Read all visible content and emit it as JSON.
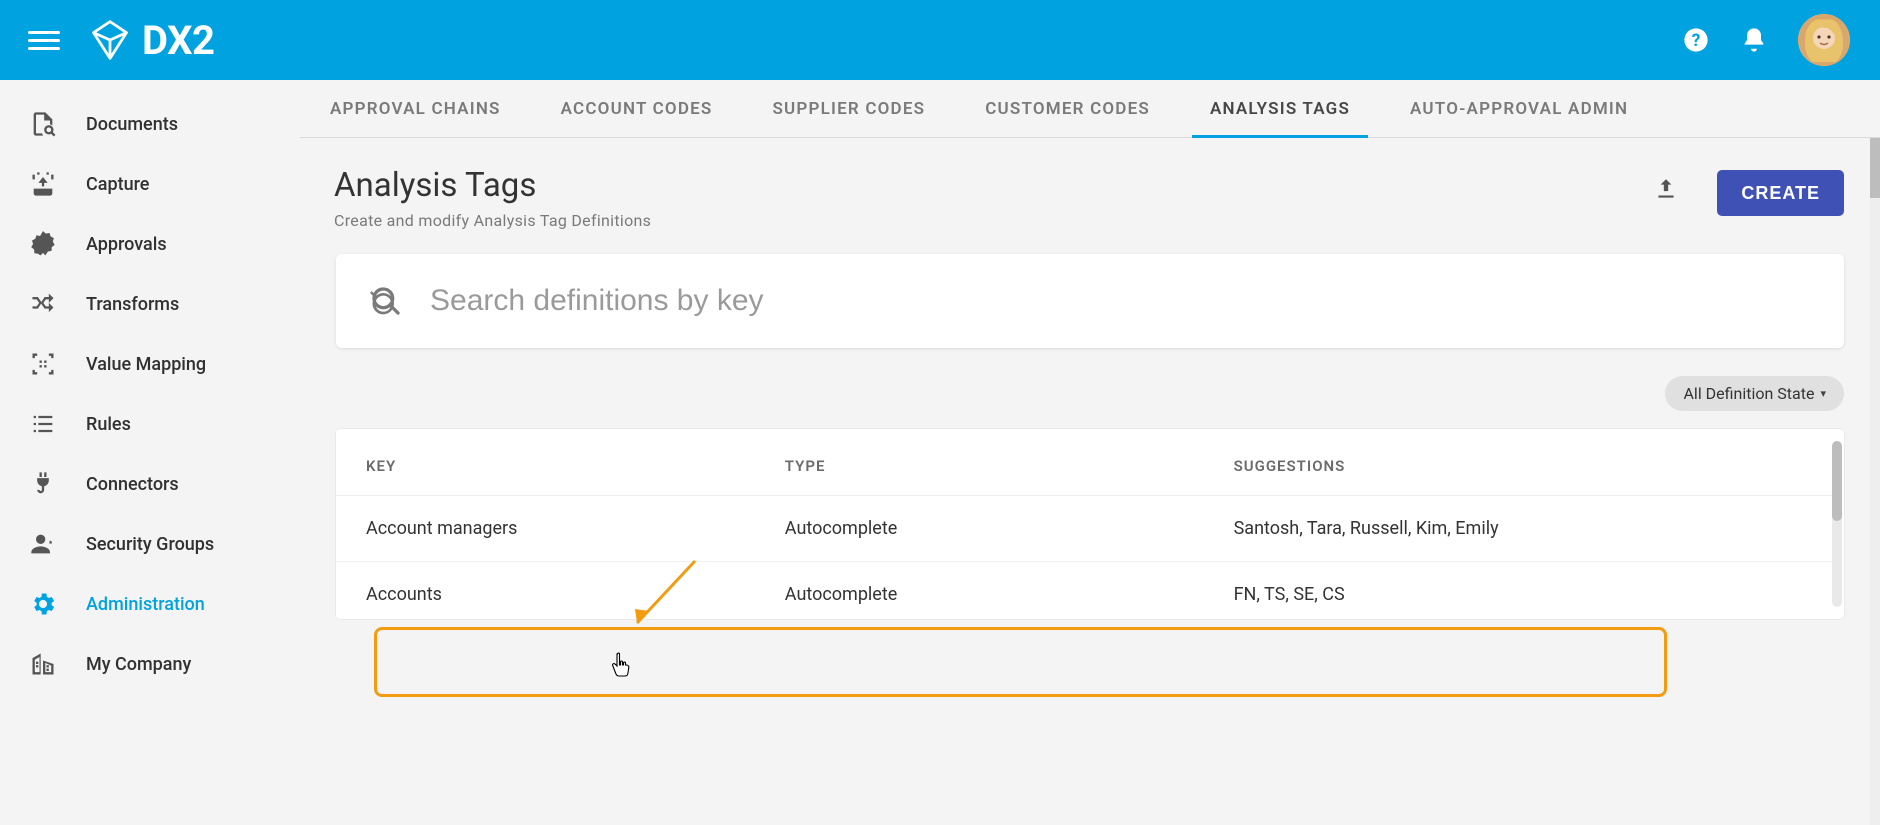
{
  "app": {
    "name": "DX2"
  },
  "sidebar": {
    "items": [
      {
        "label": "Documents"
      },
      {
        "label": "Capture"
      },
      {
        "label": "Approvals"
      },
      {
        "label": "Transforms"
      },
      {
        "label": "Value Mapping"
      },
      {
        "label": "Rules"
      },
      {
        "label": "Connectors"
      },
      {
        "label": "Security Groups"
      },
      {
        "label": "Administration"
      },
      {
        "label": "My Company"
      }
    ]
  },
  "tabs": [
    {
      "label": "APPROVAL CHAINS"
    },
    {
      "label": "ACCOUNT CODES"
    },
    {
      "label": "SUPPLIER CODES"
    },
    {
      "label": "CUSTOMER CODES"
    },
    {
      "label": "ANALYSIS TAGS"
    },
    {
      "label": "AUTO-APPROVAL ADMIN"
    }
  ],
  "page": {
    "title": "Analysis Tags",
    "subtitle": "Create and modify Analysis Tag Definitions",
    "create_label": "CREATE"
  },
  "search": {
    "placeholder": "Search definitions by key"
  },
  "filter": {
    "label": "All Definition State"
  },
  "table": {
    "headers": {
      "key": "KEY",
      "type": "TYPE",
      "suggestions": "SUGGESTIONS"
    },
    "rows": [
      {
        "key": "Account managers",
        "type": "Autocomplete",
        "suggestions": "Santosh, Tara, Russell, Kim, Emily"
      },
      {
        "key": "Accounts",
        "type": "Autocomplete",
        "suggestions": "FN, TS, SE, CS"
      }
    ]
  }
}
